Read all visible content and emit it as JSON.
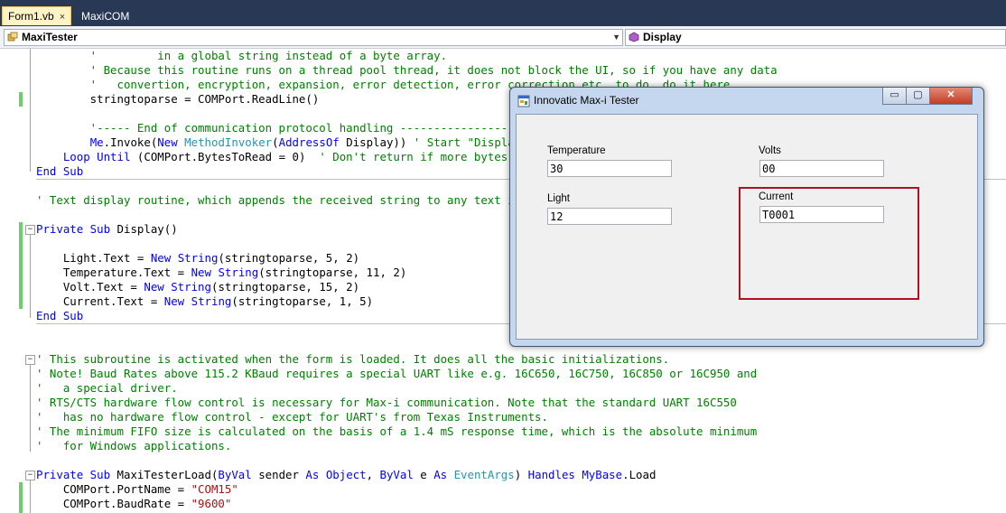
{
  "tabs": [
    {
      "label": "Form1.vb",
      "close": "×"
    },
    {
      "label": "MaxiCOM"
    }
  ],
  "navbar": {
    "class_combo": "MaxiTester",
    "method_combo": "Display"
  },
  "code_lines": [
    [
      {
        "t": "        ' ",
        "c": "cm"
      },
      {
        "t": "        in a global string instead of a byte array.",
        "c": "cm"
      }
    ],
    [
      {
        "t": "        ' Because this routine runs on a thread pool thread, it does not block the UI, so if you have any data",
        "c": "cm"
      }
    ],
    [
      {
        "t": "        '   convertion, encryption, expansion, error detection, error correction etc. to do, do it here.",
        "c": "cm"
      }
    ],
    [
      {
        "t": "        stringtoparse = COMPort.ReadLine()"
      }
    ],
    [
      {
        "t": ""
      }
    ],
    [
      {
        "t": "        '----- End of communication protocol handling ------------------",
        "c": "cm"
      }
    ],
    [
      {
        "t": "        "
      },
      {
        "t": "Me",
        "c": "kw"
      },
      {
        "t": ".Invoke("
      },
      {
        "t": "New",
        "c": "kw"
      },
      {
        "t": " "
      },
      {
        "t": "MethodInvoker",
        "c": "ty"
      },
      {
        "t": "("
      },
      {
        "t": "AddressOf",
        "c": "kw"
      },
      {
        "t": " Display)) "
      },
      {
        "t": "' Start \"Displa",
        "c": "cm"
      }
    ],
    [
      {
        "t": "    "
      },
      {
        "t": "Loop Until",
        "c": "kw"
      },
      {
        "t": " (COMPort.BytesToRead = 0)  "
      },
      {
        "t": "' Don't return if more bytes",
        "c": "cm"
      }
    ],
    [
      {
        "t": "End Sub",
        "c": "kw"
      }
    ],
    [
      {
        "t": ""
      }
    ],
    [
      {
        "t": "' Text display routine, which appends the received string to any text i",
        "c": "cm"
      }
    ],
    [
      {
        "t": ""
      }
    ],
    [
      {
        "t": "Private Sub",
        "c": "kw"
      },
      {
        "t": " Display()"
      }
    ],
    [
      {
        "t": ""
      }
    ],
    [
      {
        "t": "    Light.Text = "
      },
      {
        "t": "New",
        "c": "kw"
      },
      {
        "t": " "
      },
      {
        "t": "String",
        "c": "kw"
      },
      {
        "t": "(stringtoparse, 5, 2)"
      }
    ],
    [
      {
        "t": "    Temperature.Text = "
      },
      {
        "t": "New",
        "c": "kw"
      },
      {
        "t": " "
      },
      {
        "t": "String",
        "c": "kw"
      },
      {
        "t": "(stringtoparse, 11, 2)"
      }
    ],
    [
      {
        "t": "    Volt.Text = "
      },
      {
        "t": "New",
        "c": "kw"
      },
      {
        "t": " "
      },
      {
        "t": "String",
        "c": "kw"
      },
      {
        "t": "(stringtoparse, 15, 2)"
      }
    ],
    [
      {
        "t": "    Current.Text = "
      },
      {
        "t": "New",
        "c": "kw"
      },
      {
        "t": " "
      },
      {
        "t": "String",
        "c": "kw"
      },
      {
        "t": "(stringtoparse, 1, 5)"
      }
    ],
    [
      {
        "t": "End Sub",
        "c": "kw"
      }
    ],
    [
      {
        "t": ""
      }
    ],
    [
      {
        "t": ""
      }
    ],
    [
      {
        "t": "' This subroutine is activated when the form is loaded. It does all the basic initializations.",
        "c": "cm"
      }
    ],
    [
      {
        "t": "' Note! Baud Rates above 115.2 KBaud requires a special UART like e.g. 16C650, 16C750, 16C850 or 16C950 and",
        "c": "cm"
      }
    ],
    [
      {
        "t": "'   a special driver.",
        "c": "cm"
      }
    ],
    [
      {
        "t": "' RTS/CTS hardware flow control is necessary for Max-i communication. Note that the standard UART 16C550",
        "c": "cm"
      }
    ],
    [
      {
        "t": "'   has no hardware flow control - except for UART's from Texas Instruments.",
        "c": "cm"
      }
    ],
    [
      {
        "t": "' The minimum FIFO size is calculated on the basis of a 1.4 mS response time, which is the absolute minimum",
        "c": "cm"
      }
    ],
    [
      {
        "t": "'   for Windows applications.",
        "c": "cm"
      }
    ],
    [
      {
        "t": ""
      }
    ],
    [
      {
        "t": "Private Sub",
        "c": "kw"
      },
      {
        "t": " MaxiTesterLoad("
      },
      {
        "t": "ByVal",
        "c": "kw"
      },
      {
        "t": " sender "
      },
      {
        "t": "As",
        "c": "kw"
      },
      {
        "t": " "
      },
      {
        "t": "Object",
        "c": "kw"
      },
      {
        "t": ", "
      },
      {
        "t": "ByVal",
        "c": "kw"
      },
      {
        "t": " e "
      },
      {
        "t": "As",
        "c": "kw"
      },
      {
        "t": " "
      },
      {
        "t": "EventArgs",
        "c": "ty"
      },
      {
        "t": ") "
      },
      {
        "t": "Handles",
        "c": "kw"
      },
      {
        "t": " "
      },
      {
        "t": "MyBase",
        "c": "kw"
      },
      {
        "t": ".Load"
      }
    ],
    [
      {
        "t": "    COMPort.PortName = "
      },
      {
        "t": "\"COM15\"",
        "c": "st"
      }
    ],
    [
      {
        "t": "    COMPort.BaudRate = "
      },
      {
        "t": "\"9600\"",
        "c": "st"
      }
    ]
  ],
  "dialog": {
    "title": "Innovatic Max-i Tester",
    "controls": {
      "minimize": "▭",
      "maximize": "▢",
      "close": "✕"
    },
    "temperature": {
      "label": "Temperature",
      "value": "30"
    },
    "volts": {
      "label": "Volts",
      "value": "00"
    },
    "light": {
      "label": "Light",
      "value": "12"
    },
    "current": {
      "label": "Current",
      "value": "T0001"
    }
  },
  "colors": {
    "annotation_box": "#b01020",
    "keyword": "#0000ff",
    "comment": "#008000",
    "string": "#a31515"
  }
}
